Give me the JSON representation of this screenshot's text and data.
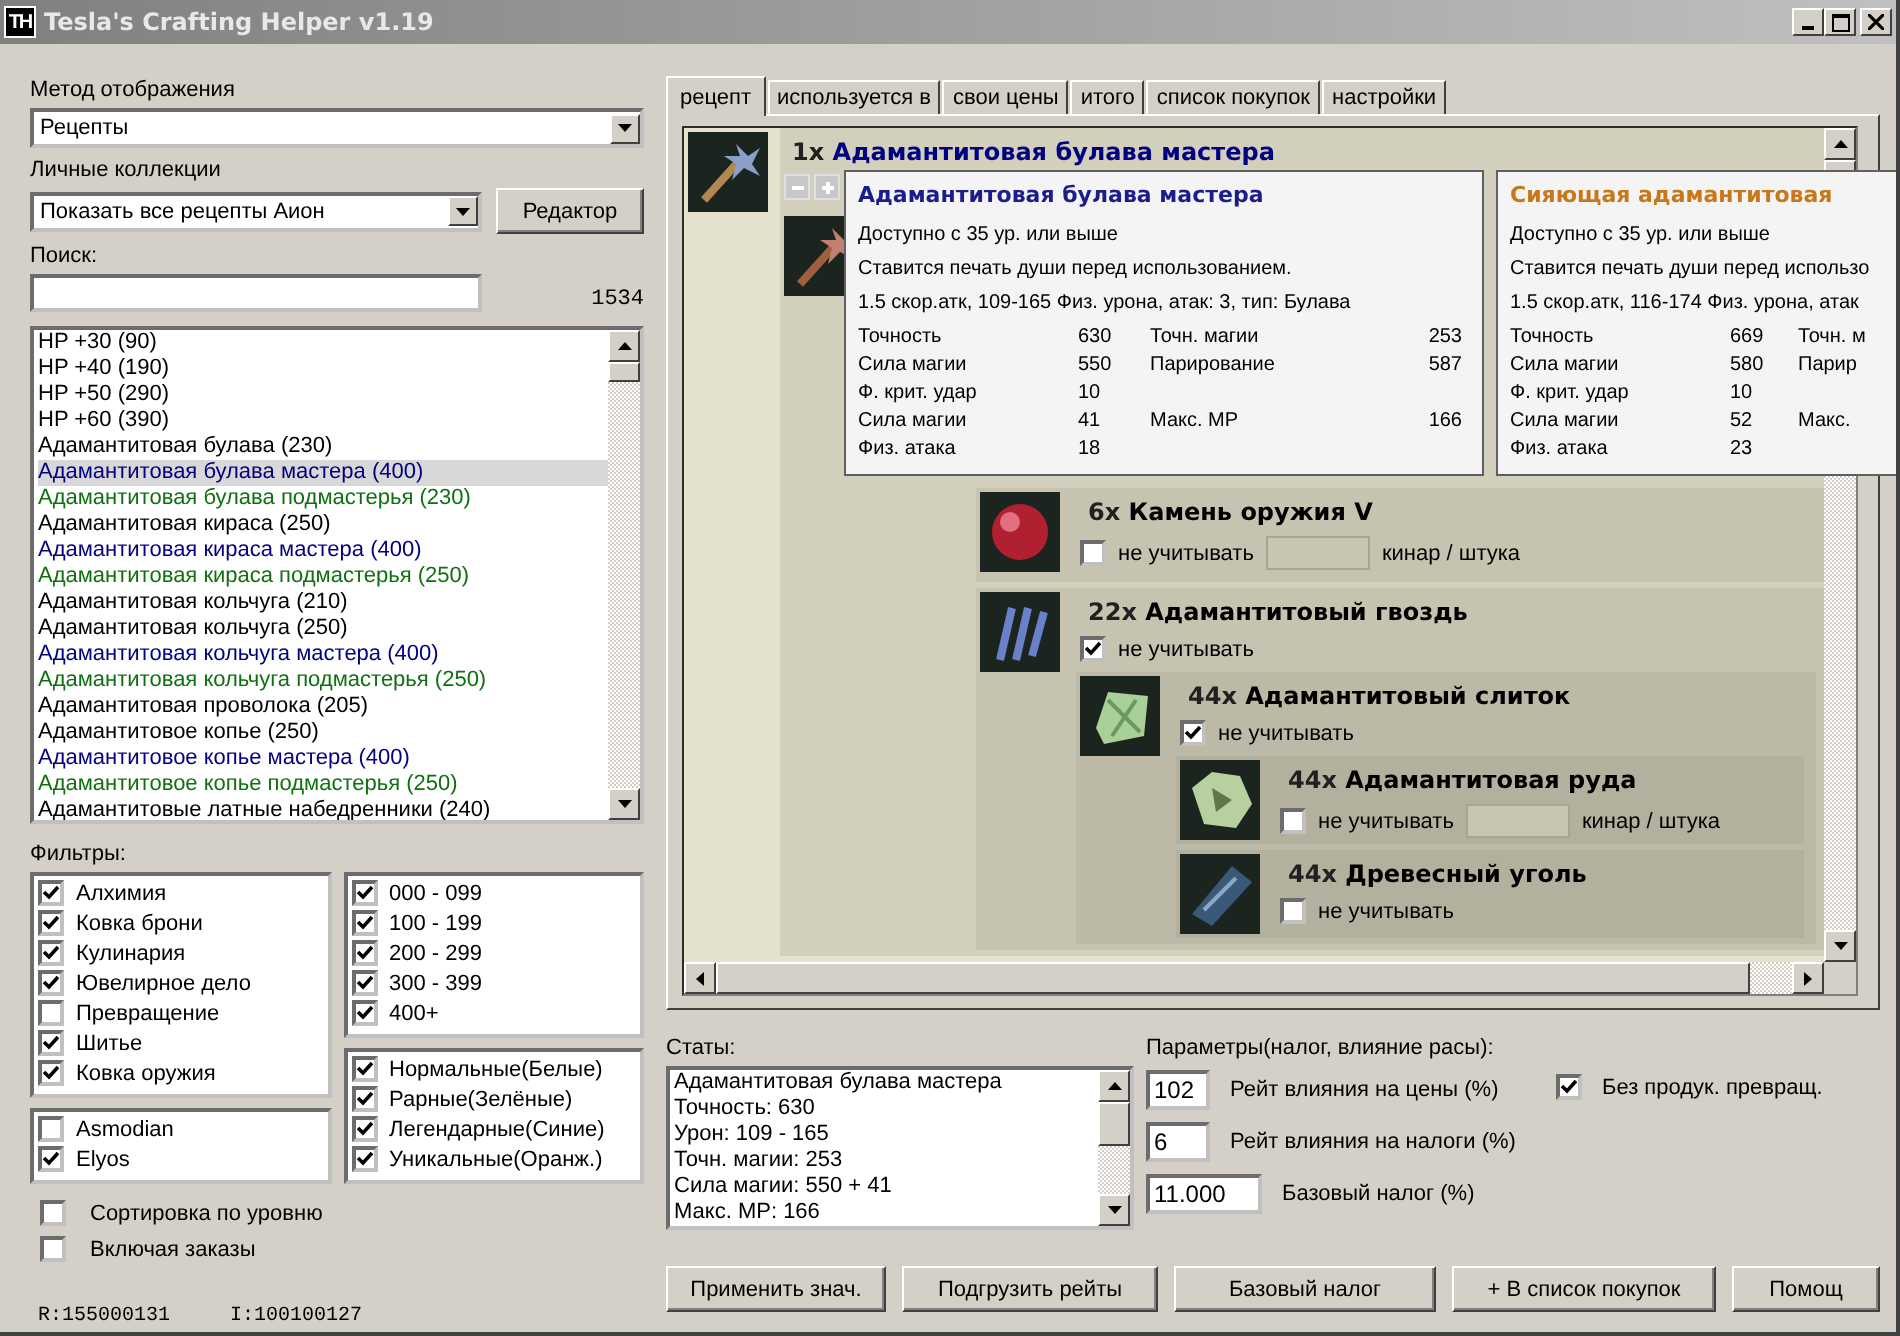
{
  "window": {
    "logo_text": "TH",
    "title": "Tesla's Crafting Helper v1.19"
  },
  "sidebar": {
    "display_mode": {
      "label": "Метод отображения",
      "value": "Рецепты"
    },
    "collections": {
      "label": "Личные коллекции",
      "value": "Показать все рецепты Аион",
      "button": "Редактор"
    },
    "search": {
      "label": "Поиск:",
      "count": "1534"
    },
    "recipes": [
      {
        "label": "HP +30 (90)",
        "color": "#000000",
        "selected": false
      },
      {
        "label": "HP +40 (190)",
        "color": "#000000",
        "selected": false
      },
      {
        "label": "HP +50 (290)",
        "color": "#000000",
        "selected": false
      },
      {
        "label": "HP +60 (390)",
        "color": "#000000",
        "selected": false
      },
      {
        "label": "Адамантитовая булава (230)",
        "color": "#000000",
        "selected": false
      },
      {
        "label": "Адамантитовая булава мастера (400)",
        "color": "#000080",
        "selected": true
      },
      {
        "label": "Адамантитовая булава подмастерья (230)",
        "color": "#107010",
        "selected": false
      },
      {
        "label": "Адамантитовая кираса (250)",
        "color": "#000000",
        "selected": false
      },
      {
        "label": "Адамантитовая кираса мастера (400)",
        "color": "#000080",
        "selected": false
      },
      {
        "label": "Адамантитовая кираса подмастерья (250)",
        "color": "#107010",
        "selected": false
      },
      {
        "label": "Адамантитовая кольчуга (210)",
        "color": "#000000",
        "selected": false
      },
      {
        "label": "Адамантитовая кольчуга (250)",
        "color": "#000000",
        "selected": false
      },
      {
        "label": "Адамантитовая кольчуга мастера (400)",
        "color": "#000080",
        "selected": false
      },
      {
        "label": "Адамантитовая кольчуга подмастерья (250)",
        "color": "#107010",
        "selected": false
      },
      {
        "label": "Адамантитовая проволока (205)",
        "color": "#000000",
        "selected": false
      },
      {
        "label": "Адамантитовое копье (250)",
        "color": "#000000",
        "selected": false
      },
      {
        "label": "Адамантитовое копье мастера (400)",
        "color": "#000080",
        "selected": false
      },
      {
        "label": "Адамантитовое копье подмастерья (250)",
        "color": "#107010",
        "selected": false
      },
      {
        "label": "Адамантитовые латные набедренники (240)",
        "color": "#000000",
        "selected": false
      }
    ],
    "filters_label": "Фильтры:",
    "filter_columns": [
      {
        "groups": [
          {
            "items": [
              {
                "label": "Алхимия",
                "checked": true
              },
              {
                "label": "Ковка брони",
                "checked": true
              },
              {
                "label": "Кулинария",
                "checked": true
              },
              {
                "label": "Ювелирное дело",
                "checked": true
              },
              {
                "label": "Превращение",
                "checked": false
              },
              {
                "label": "Шитье",
                "checked": true
              },
              {
                "label": "Ковка оружия",
                "checked": true
              }
            ]
          },
          {
            "items": [
              {
                "label": "Asmodian",
                "checked": false
              },
              {
                "label": "Elyos",
                "checked": true
              }
            ]
          }
        ]
      },
      {
        "groups": [
          {
            "items": [
              {
                "label": "000 - 099",
                "checked": true
              },
              {
                "label": "100 - 199",
                "checked": true
              },
              {
                "label": "200 - 299",
                "checked": true
              },
              {
                "label": "300 - 399",
                "checked": true
              },
              {
                "label": "400+",
                "checked": true
              }
            ]
          },
          {
            "items": [
              {
                "label": "Нормальные(Белые)",
                "checked": true
              },
              {
                "label": "Рарные(Зелёные)",
                "checked": true
              },
              {
                "label": "Легендарные(Синие)",
                "checked": true
              },
              {
                "label": "Уникальные(Оранж.)",
                "checked": true
              }
            ]
          }
        ]
      }
    ],
    "options": [
      {
        "label": "Сортировка по уровню",
        "checked": false
      },
      {
        "label": "Включая заказы",
        "checked": false
      }
    ],
    "status": [
      "R:155000131",
      "I:100100127"
    ]
  },
  "tabs": [
    {
      "label": "рецепт",
      "selected": true
    },
    {
      "label": "используется в",
      "selected": false
    },
    {
      "label": "свои цены",
      "selected": false
    },
    {
      "label": "итого",
      "selected": false
    },
    {
      "label": "список покупок",
      "selected": false
    },
    {
      "label": "настройки",
      "selected": false
    }
  ],
  "recipe": {
    "item": {
      "quantity": "1x",
      "name": "Адамантитовая булава мастера",
      "color": "#000080",
      "expand_buttons": true,
      "children": [
        {
          "children": [
            {
              "quantity": "6x",
              "name": "Камень оружия V",
              "color": "#000000",
              "ignore": {
                "label": "не учитывать",
                "checked": false
              },
              "price_unit": "кинар / штука"
            },
            {
              "quantity": "22x",
              "name": "Адамантитовый гвоздь",
              "color": "#000000",
              "ignore": {
                "label": "не учитывать",
                "checked": true
              },
              "children": [
                {
                  "quantity": "44x",
                  "name": "Адамантитовый слиток",
                  "color": "#000000",
                  "ignore": {
                    "label": "не учитывать",
                    "checked": true
                  },
                  "children": [
                    {
                      "quantity": "44x",
                      "name": "Адамантитовая руда",
                      "color": "#000000",
                      "ignore": {
                        "label": "не учитывать",
                        "checked": false
                      },
                      "price_unit": "кинар / штука"
                    },
                    {
                      "quantity": "44x",
                      "name": "Древесный уголь",
                      "color": "#000000",
                      "ignore": {
                        "label": "не учитывать",
                        "checked": false
                      }
                    }
                  ]
                }
              ]
            }
          ]
        }
      ]
    }
  },
  "tooltips": [
    {
      "title": "Адамантитовая булава мастера",
      "color": "#1c1c8c",
      "lines": [
        "Доступно с 35 ур. или выше",
        "Ставится печать души перед использованием.",
        "1.5 скор.атк, 109-165 Физ. урона, атак: 3, тип: Булава"
      ],
      "stats": [
        {
          "label": "Точность",
          "value": "630",
          "label_2": "Точн. магии",
          "value_2": "253"
        },
        {
          "label": "Сила магии",
          "value": "550",
          "label_2": "Парирование",
          "value_2": "587"
        },
        {
          "label": "Ф. крит. удар",
          "value": "10"
        },
        {
          "label": "Сила магии",
          "value": "41",
          "label_2": "Макс. MP",
          "value_2": "166"
        },
        {
          "label": "Физ. атака",
          "value": "18"
        }
      ]
    },
    {
      "title": "Сияющая адамантитовая",
      "color": "#c87818",
      "lines": [
        "Доступно с 35 ур. или выше",
        "Ставится печать души перед использо",
        "1.5 скор.атк, 116-174 Физ. урона, атак"
      ],
      "stats": [
        {
          "label": "Точность",
          "value": "669",
          "label_2": "Точн. м"
        },
        {
          "label": "Сила магии",
          "value": "580",
          "label_2": "Парир"
        },
        {
          "label": "Ф. крит. удар",
          "value": "10"
        },
        {
          "label": "Сила магии",
          "value": "52",
          "label_2": "Макс."
        },
        {
          "label": "Физ. атака",
          "value": "23"
        }
      ]
    }
  ],
  "stats": {
    "label": "Статы:",
    "lines": [
      "Адамантитовая булава мастера",
      "Точность: 630",
      "Урон: 109 - 165",
      "Точн. магии: 253",
      "Сила магии: 550 + 41",
      "Макс. MP: 166"
    ]
  },
  "parameters": {
    "label": "Параметры(налог, влияние расы):",
    "fields": [
      {
        "value": "102",
        "label": "Рейт влияния на цены (%)"
      },
      {
        "value": "6",
        "label": "Рейт влияния на налоги (%)"
      },
      {
        "value": "11.000",
        "label": "Базовый налог (%)"
      }
    ],
    "toggle": {
      "label": "Без продук. превращ.",
      "checked": true
    }
  },
  "buttons": [
    "Применить знач.",
    "Подгрузить рейты",
    "Базовый налог",
    "+ В список покупок",
    "Помощ"
  ]
}
